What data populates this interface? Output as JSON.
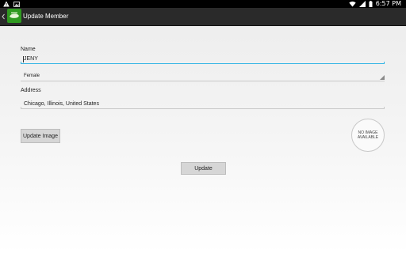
{
  "status_bar": {
    "time": "6:57 PM",
    "icons": [
      "warning-icon",
      "image-icon",
      "wifi-icon",
      "signal-icon",
      "battery-icon"
    ]
  },
  "action_bar": {
    "title": "Update Member",
    "icons": [
      "chevron-left-icon",
      "app-logo-icon"
    ],
    "colors": {
      "background": "#2a2a2a",
      "logo": "#2f9a20"
    }
  },
  "form": {
    "name": {
      "label": "Name",
      "value": "JENY"
    },
    "gender": {
      "value": "Female"
    },
    "address": {
      "label": "Address",
      "value": "Chicago, Illinois, United States"
    },
    "colors": {
      "active_underline": "#33b5e5",
      "inactive_underline": "#c9c9c9"
    }
  },
  "update_image_button": {
    "label": "Update Image"
  },
  "photo_placeholder": {
    "line1": "NO IMAGE",
    "line2": "AVAILABLE"
  },
  "update_button": {
    "label": "Update"
  }
}
